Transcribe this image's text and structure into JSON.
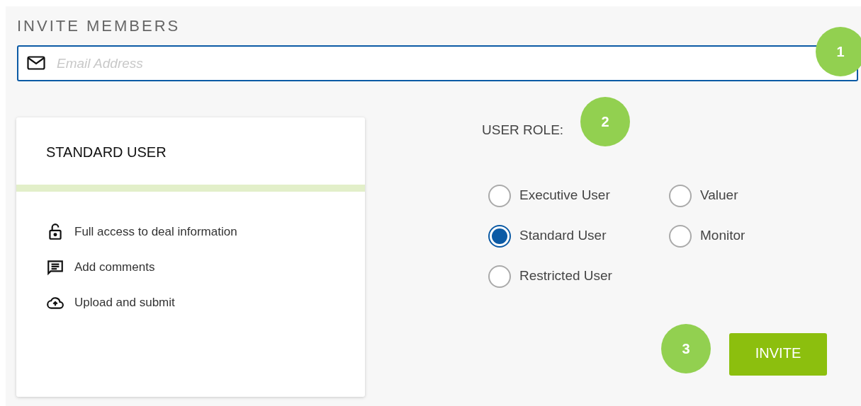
{
  "title": "INVITE MEMBERS",
  "email_field": {
    "placeholder": "Email Address"
  },
  "step_badges": [
    "1",
    "2",
    "3"
  ],
  "role_card": {
    "title": "STANDARD USER",
    "permissions": [
      {
        "kind": "lock",
        "text": "Full access to deal information"
      },
      {
        "kind": "comment",
        "text": "Add comments"
      },
      {
        "kind": "upload",
        "text": "Upload and submit"
      }
    ]
  },
  "user_role": {
    "label": "USER ROLE:",
    "options": [
      {
        "label": "Executive User",
        "selected": false
      },
      {
        "label": "Valuer",
        "selected": false
      },
      {
        "label": "Standard User",
        "selected": true
      },
      {
        "label": "Monitor",
        "selected": false
      },
      {
        "label": "Restricted User",
        "selected": false
      }
    ]
  },
  "invite_button": "INVITE"
}
